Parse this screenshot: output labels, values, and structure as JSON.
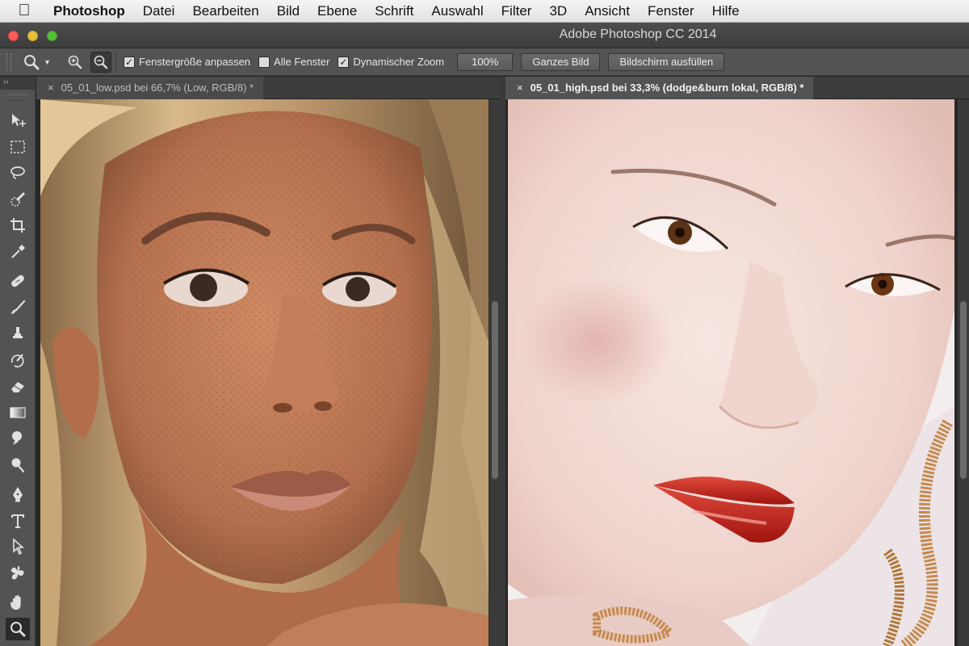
{
  "menubar": {
    "apple_icon": "apple-icon",
    "app_name": "Photoshop",
    "items": [
      "Datei",
      "Bearbeiten",
      "Bild",
      "Ebene",
      "Schrift",
      "Auswahl",
      "Filter",
      "3D",
      "Ansicht",
      "Fenster",
      "Hilfe"
    ]
  },
  "window": {
    "title": "Adobe Photoshop CC 2014"
  },
  "options_bar": {
    "tool_icon": "zoom-tool-icon",
    "zoom_in_icon": "zoom-in-icon",
    "zoom_out_icon": "zoom-out-icon",
    "resize_windows": {
      "label": "Fenstergröße anpassen",
      "checked": true
    },
    "zoom_all_windows": {
      "label": "Alle Fenster",
      "checked": false
    },
    "scrubby_zoom": {
      "label": "Dynamischer Zoom",
      "checked": true
    },
    "btn_100": "100%",
    "btn_fit": "Ganzes Bild",
    "btn_fill": "Bildschirm ausfüllen"
  },
  "toolbox": {
    "collapse_label": "››",
    "tools": [
      "move-tool-icon",
      "rectangular-marquee-icon",
      "lasso-icon",
      "quick-selection-icon",
      "crop-icon",
      "eyedropper-icon",
      "healing-brush-icon",
      "brush-icon",
      "clone-stamp-icon",
      "history-brush-icon",
      "eraser-icon",
      "gradient-icon",
      "blur-icon",
      "dodge-icon",
      "pen-icon",
      "type-icon",
      "path-selection-icon",
      "custom-shape-icon",
      "hand-icon",
      "zoom-icon"
    ],
    "active_tool": "zoom-icon"
  },
  "documents": [
    {
      "close": "×",
      "title": "05_01_low.psd bei 66,7% (Low, RGB/8) *",
      "active": false
    },
    {
      "close": "×",
      "title": "05_01_high.psd bei 33,3% (dodge&burn lokal, RGB/8) *",
      "active": true
    }
  ],
  "colors": {
    "menubar": "#ececec",
    "panel": "#535353",
    "pasteboard": "#282828",
    "skin_low": "#b9714e",
    "skin_high": "#f2d9d3",
    "lips_high": "#c3221c",
    "hair_low": "#c6a272"
  }
}
